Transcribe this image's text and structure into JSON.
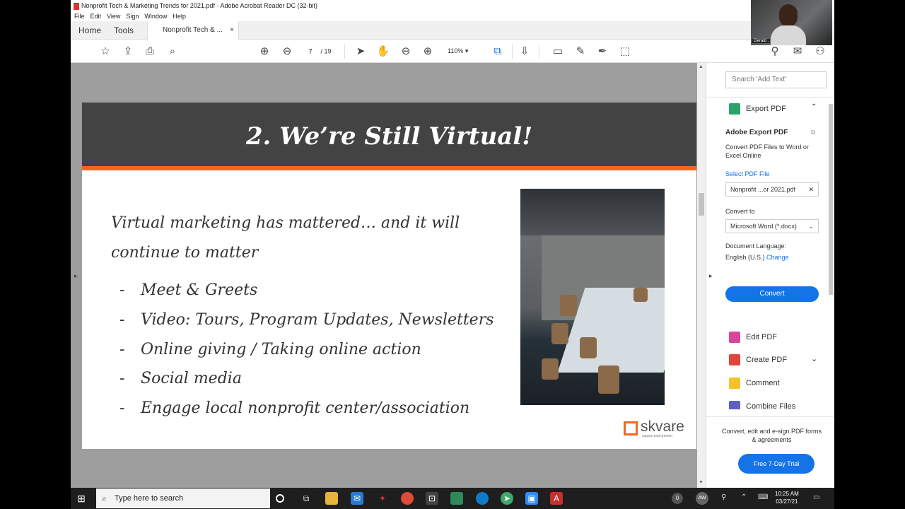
{
  "window": {
    "title": "Nonprofit Tech & Marketing Trends for 2021.pdf - Adobe Acrobat Reader DC (32-bit)",
    "menu": [
      "File",
      "Edit",
      "View",
      "Sign",
      "Window",
      "Help"
    ]
  },
  "tabs": {
    "home": "Home",
    "tools": "Tools",
    "document": "Nonprofit Tech & ...",
    "close_glyph": "×"
  },
  "toolbar": {
    "page_current": "7",
    "page_total": "/ 19",
    "zoom": "110%",
    "icons": [
      "star-icon",
      "upload-icon",
      "print-icon",
      "zoom-search-icon",
      "page-up-icon",
      "page-down-icon",
      "select-arrow-icon",
      "hand-icon",
      "zoom-out-icon",
      "zoom-in-icon",
      "fit-page-icon",
      "scroll-mode-icon",
      "comment-icon",
      "highlight-icon",
      "sign-icon",
      "redact-icon"
    ]
  },
  "slide": {
    "title": "2. We’re Still Virtual!",
    "intro": "Virtual marketing has mattered… and it will continue to matter",
    "bullet_dash": "-",
    "bullets": [
      "Meet & Greets",
      "Video: Tours, Program Updates, Newsletters",
      "Online giving / Taking online action",
      "Social media",
      "Engage local nonprofit center/association"
    ],
    "logo_word": "skvare",
    "logo_tag": "square and uneven"
  },
  "right_panel": {
    "search_placeholder": "Search 'Add Text'",
    "export_title": "Export PDF",
    "adobe_export_title": "Adobe Export PDF",
    "description": "Convert PDF Files to Word or Excel Online",
    "select_label": "Select PDF File",
    "selected_file": "Nonprofit ...or 2021.pdf",
    "convert_to_label": "Convert to",
    "convert_to_value": "Microsoft Word (*.docx)",
    "doc_language_label": "Document Language:",
    "doc_language_value": "English (U.S.)",
    "change_link": "Change",
    "convert_button": "Convert",
    "tools": [
      {
        "label": "Edit PDF",
        "color": "#d9459c"
      },
      {
        "label": "Create PDF",
        "color": "#e0453d"
      },
      {
        "label": "Comment",
        "color": "#f5c227"
      },
      {
        "label": "Combine Files",
        "color": "#5b5fc7"
      }
    ],
    "promo_text": "Convert, edit and e-sign PDF forms & agreements",
    "trial_button": "Free 7-Day Trial"
  },
  "webcam": {
    "name": "Gerald ."
  },
  "taskbar": {
    "search_placeholder": "Type here to search",
    "badge_left": "0",
    "badge_right": "AW",
    "time": "10:25 AM",
    "date": "03/27/21"
  }
}
